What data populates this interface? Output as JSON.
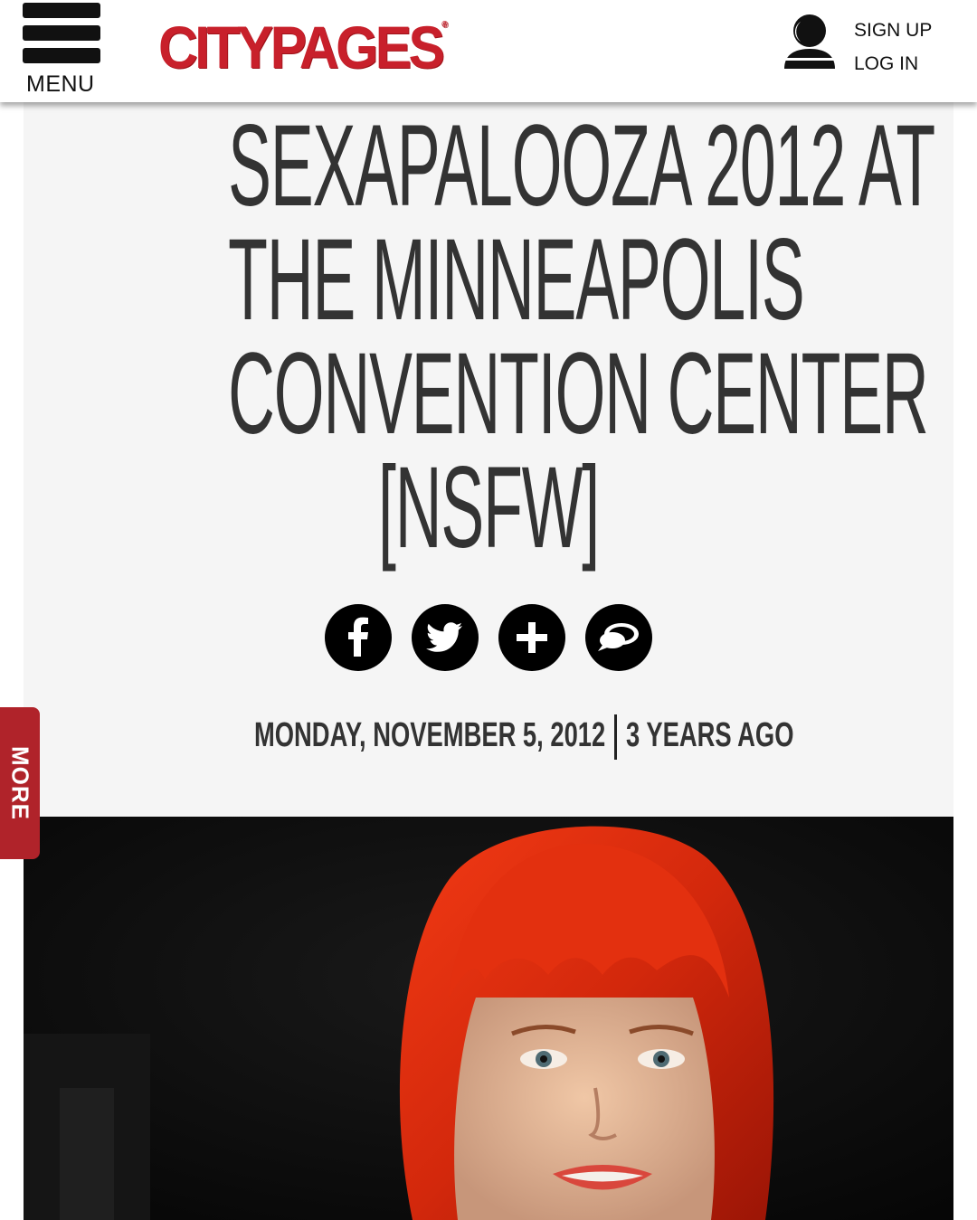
{
  "header": {
    "menu_label": "MENU",
    "logo_text": "CITYPAGES",
    "logo_mark": "®",
    "sign_up": "SIGN UP",
    "log_in": "LOG IN",
    "brand_color": "#c8202b"
  },
  "article": {
    "headline_lines": [
      "SEXAPALOOZA 2012 AT",
      "THE MINNEAPOLIS",
      "CONVENTION CENTER",
      "[NSFW]"
    ],
    "share_icons": [
      "facebook-icon",
      "twitter-icon",
      "plus-icon",
      "comment-icon"
    ],
    "date": "MONDAY, NOVEMBER 5, 2012",
    "age": "3 YEARS AGO"
  },
  "side_tab": {
    "label": "MORE",
    "color": "#b0232a"
  }
}
